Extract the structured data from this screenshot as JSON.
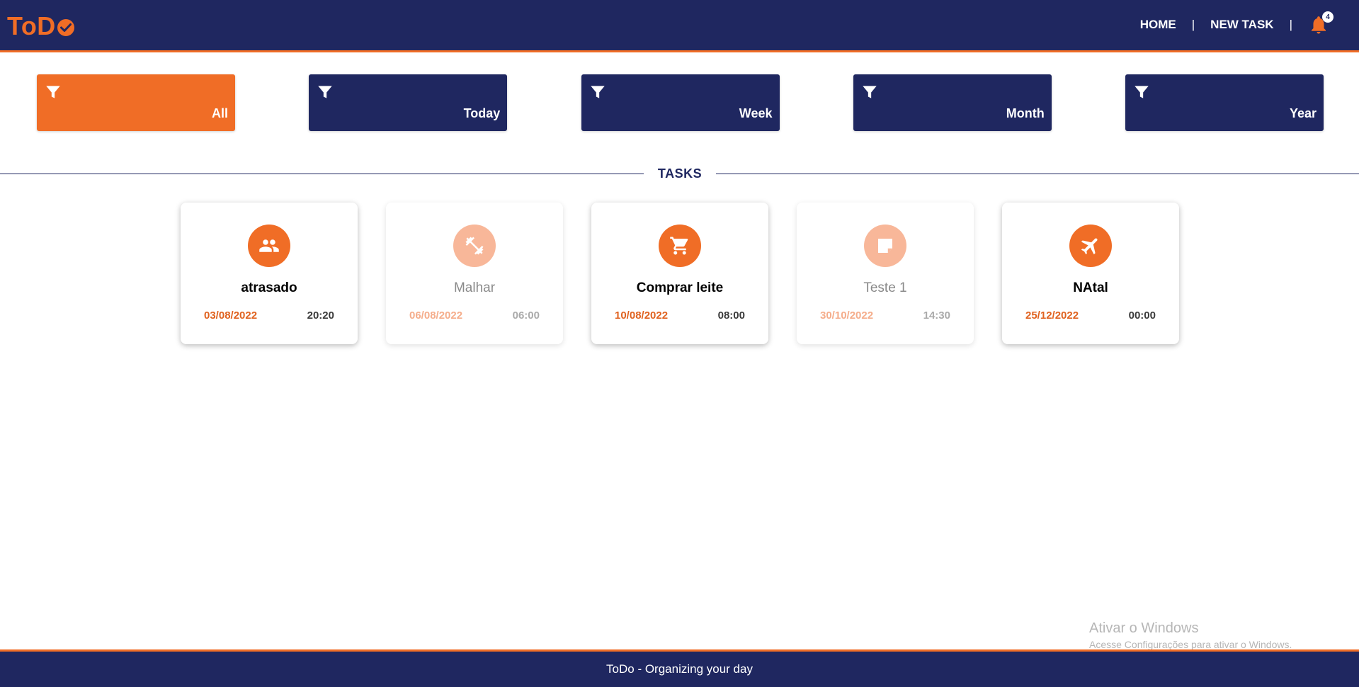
{
  "header": {
    "logo_text": "ToD",
    "nav": {
      "home": "HOME",
      "separator": "|",
      "new_task": "NEW TASK"
    },
    "notifications": {
      "icon": "bell-icon",
      "count": "4"
    }
  },
  "filters": [
    {
      "label": "All",
      "active": true,
      "icon": "filter-icon"
    },
    {
      "label": "Today",
      "active": false,
      "icon": "filter-icon"
    },
    {
      "label": "Week",
      "active": false,
      "icon": "filter-icon"
    },
    {
      "label": "Month",
      "active": false,
      "icon": "filter-icon"
    },
    {
      "label": "Year",
      "active": false,
      "icon": "filter-icon"
    }
  ],
  "section_title": "TASKS",
  "tasks": [
    {
      "title": "atrasado",
      "date": "03/08/2022",
      "time": "20:20",
      "icon": "group-icon",
      "faded": false
    },
    {
      "title": "Malhar",
      "date": "06/08/2022",
      "time": "06:00",
      "icon": "dumbbell-icon",
      "faded": true
    },
    {
      "title": "Comprar leite",
      "date": "10/08/2022",
      "time": "08:00",
      "icon": "shopping-cart-icon",
      "faded": false
    },
    {
      "title": "Teste 1",
      "date": "30/10/2022",
      "time": "14:30",
      "icon": "sticky-note-icon",
      "faded": true
    },
    {
      "title": "NAtal",
      "date": "25/12/2022",
      "time": "00:00",
      "icon": "airplane-icon",
      "faded": false
    }
  ],
  "watermark": {
    "title": "Ativar o Windows",
    "subtitle": "Acesse Configurações para ativar o Windows."
  },
  "footer": {
    "text": "ToDo - Organizing your day"
  },
  "colors": {
    "navy": "#1f2760",
    "orange": "#f06d26",
    "orange_faded": "#f8b799"
  }
}
